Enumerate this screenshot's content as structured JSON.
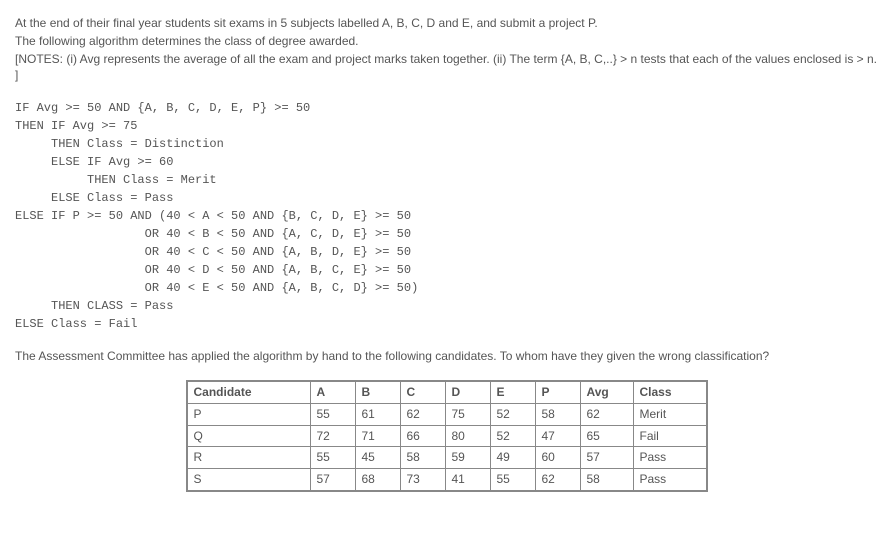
{
  "intro": {
    "line1": "At the end of their final year students sit exams in 5 subjects labelled A, B, C, D and E, and submit a project P.",
    "line2": "The following algorithm determines the class of degree awarded.",
    "line3": "[NOTES: (i) Avg represents the average of all the exam and project marks taken together. (ii) The term {A, B, C,..} > n tests that each of the values enclosed is > n. ]"
  },
  "code": {
    "l1": "IF Avg >= 50 AND {A, B, C, D, E, P} >= 50",
    "l2": "THEN IF Avg >= 75",
    "l3": "     THEN Class = Distinction",
    "l4": "     ELSE IF Avg >= 60",
    "l5": "          THEN Class = Merit",
    "l6": "     ELSE Class = Pass",
    "l7": "ELSE IF P >= 50 AND (40 < A < 50 AND {B, C, D, E} >= 50",
    "l8": "                  OR 40 < B < 50 AND {A, C, D, E} >= 50",
    "l9": "                  OR 40 < C < 50 AND {A, B, D, E} >= 50",
    "l10": "                  OR 40 < D < 50 AND {A, B, C, E} >= 50",
    "l11": "                  OR 40 < E < 50 AND {A, B, C, D} >= 50)",
    "l12": "     THEN CLASS = Pass",
    "l13": "ELSE Class = Fail"
  },
  "question": "The Assessment Committee has applied the algorithm by hand to the following candidates. To whom have they given the wrong classification?",
  "table": {
    "headers": {
      "candidate": "Candidate",
      "a": "A",
      "b": "B",
      "c": "C",
      "d": "D",
      "e": "E",
      "p": "P",
      "avg": "Avg",
      "class": "Class"
    },
    "rows": [
      {
        "candidate": "P",
        "a": "55",
        "b": "61",
        "c": "62",
        "d": "75",
        "e": "52",
        "p": "58",
        "avg": "62",
        "class": "Merit"
      },
      {
        "candidate": "Q",
        "a": "72",
        "b": "71",
        "c": "66",
        "d": "80",
        "e": "52",
        "p": "47",
        "avg": "65",
        "class": "Fail"
      },
      {
        "candidate": "R",
        "a": "55",
        "b": "45",
        "c": "58",
        "d": "59",
        "e": "49",
        "p": "60",
        "avg": "57",
        "class": "Pass"
      },
      {
        "candidate": "S",
        "a": "57",
        "b": "68",
        "c": "73",
        "d": "41",
        "e": "55",
        "p": "62",
        "avg": "58",
        "class": "Pass"
      }
    ]
  }
}
